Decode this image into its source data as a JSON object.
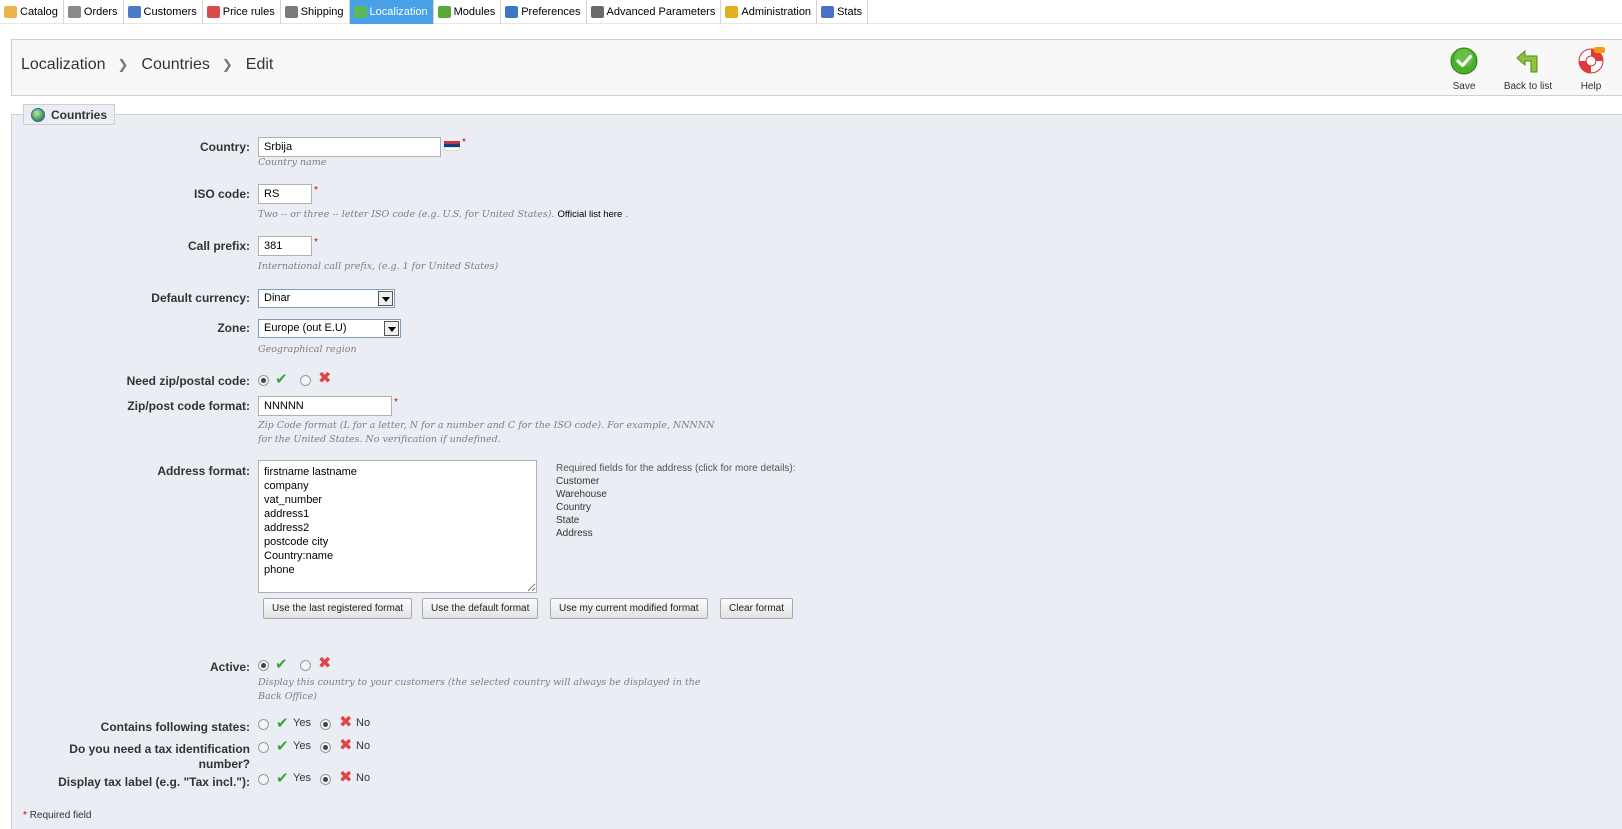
{
  "tabs": [
    {
      "label": "Catalog",
      "icon": "folder-icon",
      "color": "#e8b64a"
    },
    {
      "label": "Orders",
      "icon": "cart-icon",
      "color": "#8a8a8a"
    },
    {
      "label": "Customers",
      "icon": "user-icon",
      "color": "#4a7ac8"
    },
    {
      "label": "Price rules",
      "icon": "price-tag-icon",
      "color": "#d84b4b"
    },
    {
      "label": "Shipping",
      "icon": "truck-icon",
      "color": "#7a7a7a"
    },
    {
      "label": "Localization",
      "icon": "globe-icon",
      "color": "#5cb85c",
      "active": true
    },
    {
      "label": "Modules",
      "icon": "puzzle-icon",
      "color": "#5aa83c"
    },
    {
      "label": "Preferences",
      "icon": "preferences-icon",
      "color": "#3c78c8"
    },
    {
      "label": "Advanced Parameters",
      "icon": "wrench-icon",
      "color": "#6a6a6a"
    },
    {
      "label": "Administration",
      "icon": "key-icon",
      "color": "#e0b020"
    },
    {
      "label": "Stats",
      "icon": "bar-chart-icon",
      "color": "#4a6fc8"
    }
  ],
  "breadcrumb": [
    "Localization",
    "Countries",
    "Edit"
  ],
  "toolbar": {
    "save": "Save",
    "back": "Back to list",
    "help": "Help"
  },
  "panel": {
    "legend": "Countries"
  },
  "form": {
    "country": {
      "label": "Country:",
      "value": "Srbija",
      "hint": "Country name"
    },
    "iso": {
      "label": "ISO code:",
      "value": "RS",
      "hint": "Two -- or three -- letter ISO code (e.g. U.S. for United States).",
      "link": "Official list here",
      "hint_end": "."
    },
    "call_prefix": {
      "label": "Call prefix:",
      "value": "381",
      "hint": "International call prefix, (e.g. 1 for United States)"
    },
    "currency": {
      "label": "Default currency:",
      "value": "Dinar"
    },
    "zone": {
      "label": "Zone:",
      "value": "Europe (out E.U)",
      "hint": "Geographical region"
    },
    "need_zip": {
      "label": "Need zip/postal code:"
    },
    "zip_format": {
      "label": "Zip/post code format:",
      "value": "NNNNN",
      "hint1": "Zip Code format (L for a letter, N for a number and C for the ISO code). For example, NNNNN",
      "hint2": "for the United States. No verification if undefined."
    },
    "address_format": {
      "label": "Address format:",
      "lines": [
        "firstname lastname",
        "company",
        "vat_number",
        "address1",
        "address2",
        "postcode city",
        "Country:name",
        "phone"
      ],
      "required_head": "Required fields for the address (click for more details):",
      "required": [
        "Customer",
        "Warehouse",
        "Country",
        "State",
        "Address"
      ],
      "buttons": [
        "Use the last registered format",
        "Use the default format",
        "Use my current modified format",
        "Clear format"
      ]
    },
    "active": {
      "label": "Active:",
      "hint1": "Display this country to your customers (the selected country will always be displayed in the",
      "hint2": "Back Office)"
    },
    "states": {
      "label": "Contains following states:",
      "yes": "Yes",
      "no": "No"
    },
    "tax_id": {
      "label1": "Do you need a tax identification",
      "label2": "number?",
      "yes": "Yes",
      "no": "No"
    },
    "tax_label": {
      "label": "Display tax label (e.g. \"Tax incl.\"):",
      "yes": "Yes",
      "no": "No"
    },
    "required_note": "Required field",
    "required_mark": "*"
  }
}
